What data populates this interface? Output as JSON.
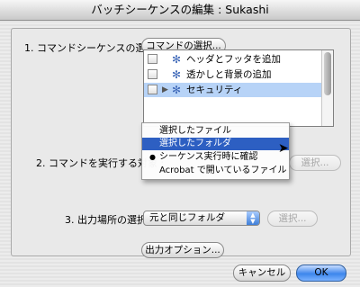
{
  "window": {
    "title": "バッチシーケンスの編集 : Sukashi"
  },
  "section1": {
    "label": "1. コマンドシーケンスの選択 :",
    "button": "コマンドの選択..."
  },
  "commands": [
    {
      "label": "ヘッダとフッタを追加",
      "selected": false,
      "expander": false
    },
    {
      "label": "透かしと背景の追加",
      "selected": false,
      "expander": false
    },
    {
      "label": "セキュリティ",
      "selected": true,
      "expander": true
    }
  ],
  "section2": {
    "label": "2. コマンドを実行する対象 :",
    "choose_button": "選択..."
  },
  "target_menu": {
    "items": [
      {
        "label": "選択したファイル",
        "highlighted": false,
        "checked": false
      },
      {
        "label": "選択したフォルダ",
        "highlighted": true,
        "checked": false
      },
      {
        "label": "シーケンス実行時に確認",
        "highlighted": false,
        "checked": true
      },
      {
        "label": "Acrobat で開いているファイル",
        "highlighted": false,
        "checked": false
      }
    ]
  },
  "section3": {
    "label": "3. 出力場所の選択 :",
    "select_value": "元と同じフォルダ",
    "choose_button": "選択..."
  },
  "output_options": {
    "label": "出力オプション..."
  },
  "footer": {
    "cancel": "キャンセル",
    "ok": "OK"
  },
  "icons": {
    "command": "gear-icon",
    "expander": "disclosure-triangle-icon",
    "check": "bullet-icon"
  },
  "colors": {
    "highlight": "#2d5fc2",
    "selected_row": "#b7d3f7",
    "default_button": "#3d86ec"
  }
}
